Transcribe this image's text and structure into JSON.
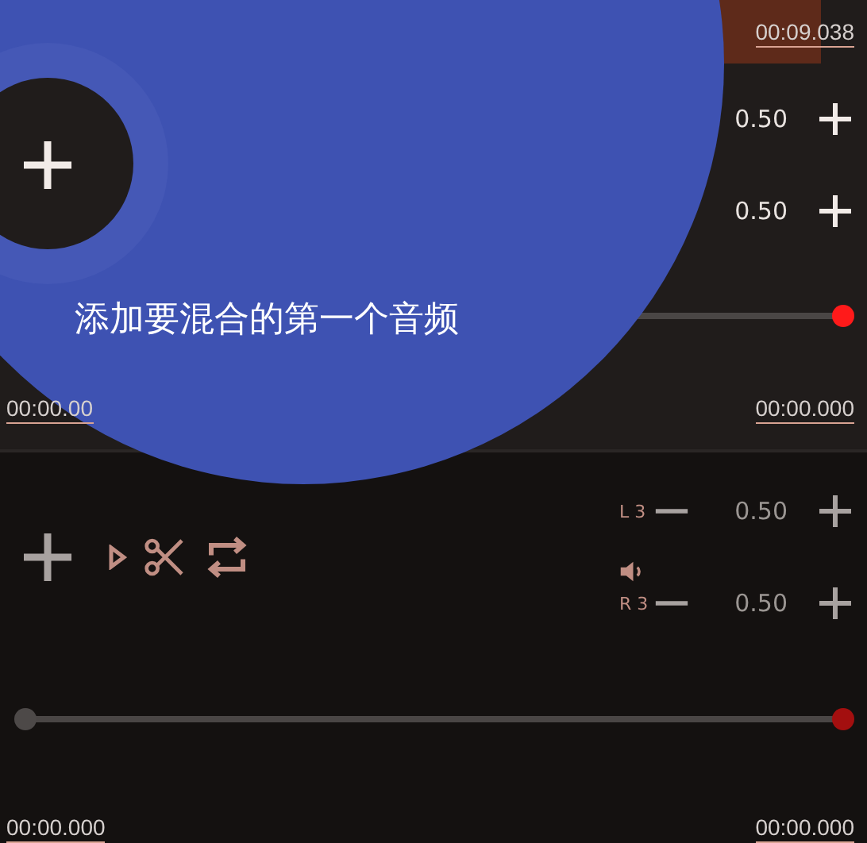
{
  "tracks": [
    {
      "active": true,
      "end_time": "00:09.038",
      "channels": [
        {
          "value": "0.50"
        },
        {
          "value": "0.50"
        }
      ],
      "thumbs": [
        {
          "kind": "end",
          "level": 1
        }
      ],
      "range_start": "00:00.00",
      "range_end": "00:00.000"
    },
    {
      "active": false,
      "tools": [
        {
          "kind": "play"
        },
        {
          "kind": "cut"
        },
        {
          "kind": "repeat"
        }
      ],
      "speaker": true,
      "channels": [
        {
          "label": "L 3",
          "value": "0.50"
        },
        {
          "label": "R 3",
          "value": "0.50"
        }
      ],
      "thumbs": [
        {
          "kind": "start",
          "level": 0
        },
        {
          "kind": "end",
          "level": 1
        }
      ],
      "range_start": "00:00.000",
      "range_end": "00:00.000"
    }
  ],
  "tutorial": {
    "text": "添加要混合的第一个音频"
  }
}
